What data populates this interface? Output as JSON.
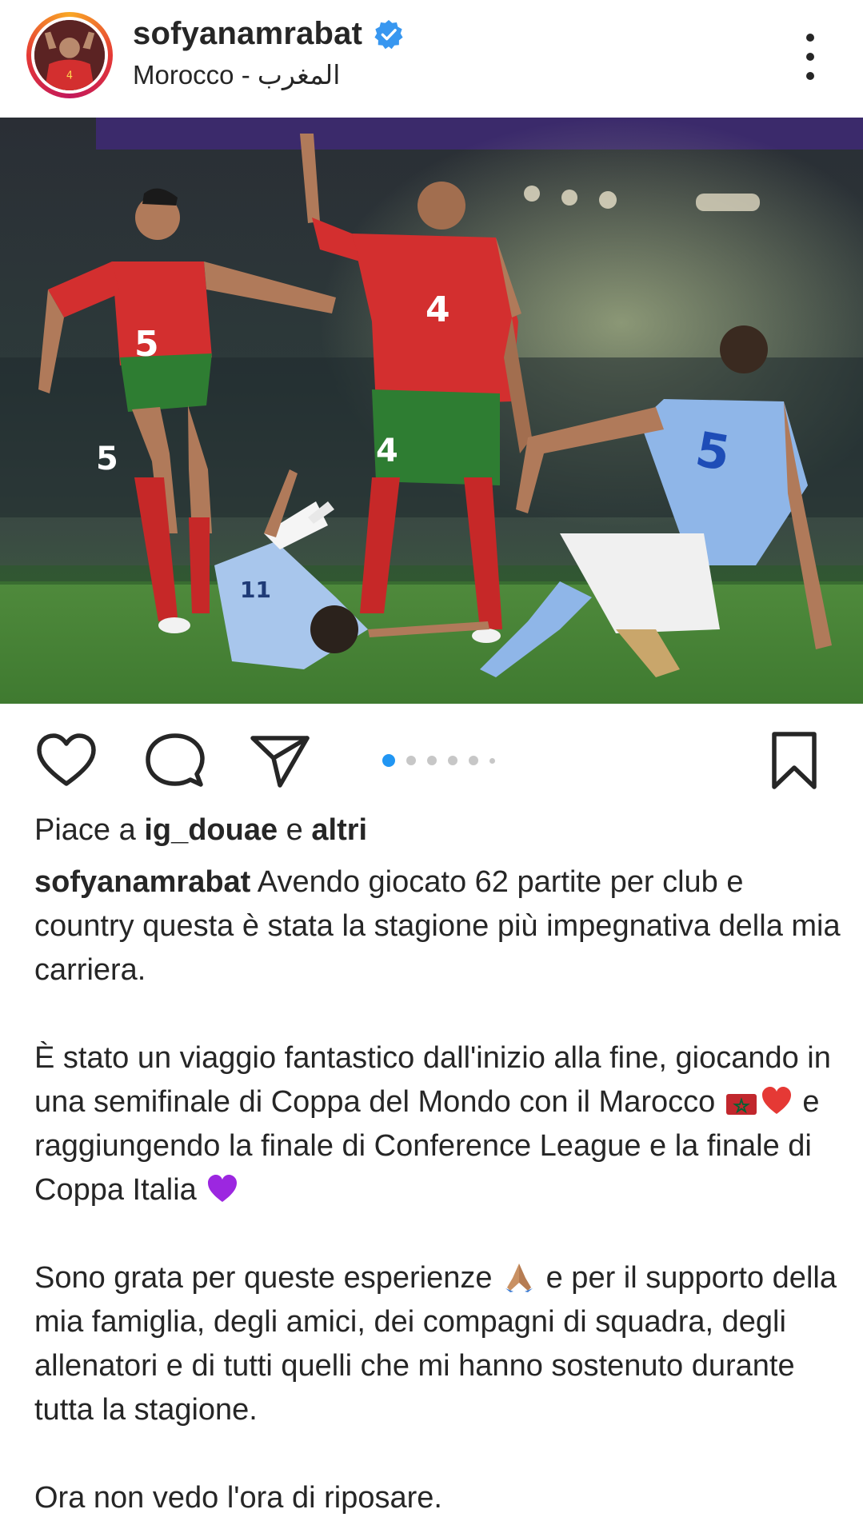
{
  "header": {
    "username": "sofyanamrabat",
    "location": "Morocco - المغرب",
    "verified_icon": "verified-badge-icon",
    "more_icon": "more-vertical-icon"
  },
  "post": {
    "image_alt": "Match photo: Morocco players in red shirts numbered 4 and 5, Spain players in light blue",
    "carousel": {
      "total_dots": 6,
      "active_index": 0
    }
  },
  "actions": {
    "like_icon": "heart-icon",
    "comment_icon": "comment-bubble-icon",
    "share_icon": "paper-plane-icon",
    "save_icon": "bookmark-icon"
  },
  "likes": {
    "prefix": "Piace a ",
    "user": "ig_douae",
    "middle": " e ",
    "others": "altri"
  },
  "caption": {
    "author": "sofyanamrabat",
    "p1": " Avendo giocato 62 partite per club e country questa è stata la stagione più impegnativa della mia carriera.",
    "p2a": "È stato un viaggio fantastico dall'inizio alla fine, giocando in una semifinale di Coppa del Mondo con il Marocco ",
    "p2b": " e raggiungendo la finale di Conference League e la finale di Coppa Italia ",
    "p3a": "Sono grata per queste esperienze ",
    "p3b": " e per il supporto della mia famiglia, degli amici, dei compagni di squadra, degli allenatori e di tutti quelli che mi hanno sostenuto durante tutta la stagione.",
    "p4": "Ora non vedo l'ora di riposare.",
    "emojis": [
      "morocco-flag-emoji",
      "red-heart-emoji",
      "purple-heart-emoji",
      "praying-hands-emoji"
    ]
  },
  "colors": {
    "accent_blue": "#2196f3",
    "text": "#262626",
    "dot_inactive": "#c7c7c7",
    "morocco_red": "#d32f2f",
    "morocco_green": "#2e7d32",
    "spain_blue": "#8fb6e8"
  }
}
